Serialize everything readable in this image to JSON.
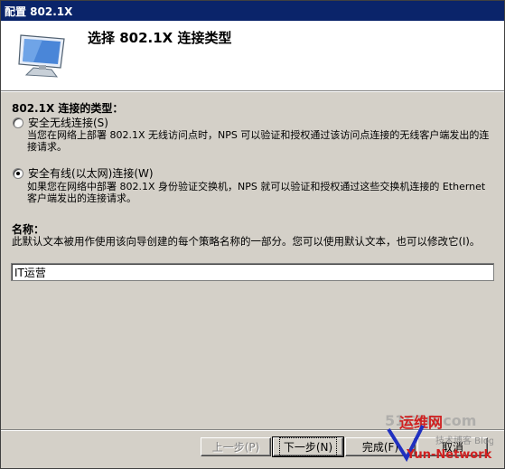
{
  "window": {
    "title": "配置 802.1X"
  },
  "header": {
    "title": "选择 802.1X 连接类型",
    "icon": "computer-monitor-icon"
  },
  "section": {
    "label": "802.1X 连接的类型："
  },
  "options": [
    {
      "label": "安全无线连接(S)",
      "checked": false,
      "description": "当您在网络上部署 802.1X 无线访问点时，NPS 可以验证和授权通过该访问点连接的无线客户端发出的连接请求。"
    },
    {
      "label": "安全有线(以太网)连接(W)",
      "checked": true,
      "description": "如果您在网络中部署 802.1X 身份验证交换机，NPS 就可以验证和授权通过这些交换机连接的 Ethernet 客户端发出的连接请求。"
    }
  ],
  "name": {
    "label": "名称：",
    "description": "此默认文本被用作使用该向导创建的每个策略名称的一部分。您可以使用默认文本，也可以修改它(I)。",
    "value": "IT运营"
  },
  "buttons": {
    "back": "上一步(P)",
    "next": "下一步(N)",
    "finish": "完成(F)",
    "cancel": "取消"
  },
  "watermark": {
    "line1": "51CTO.com",
    "line2": "技术博客 Blog",
    "line3": "Yun-Network",
    "brand": "运维网"
  },
  "colors": {
    "titlebar": "#0a246a",
    "face": "#d4d0c8",
    "watermark_red": "#d02020",
    "watermark_blue": "#2030c0"
  }
}
